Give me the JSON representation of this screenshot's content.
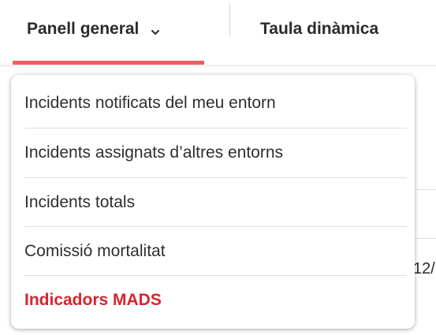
{
  "tabs": {
    "general_label": "Panell general",
    "pivot_label": "Taula dinàmica"
  },
  "dropdown": {
    "items": [
      {
        "label": "Incidents notificats del meu entorn"
      },
      {
        "label": "Incidents assignats d’altres entorns"
      },
      {
        "label": "Incidents totals"
      },
      {
        "label": "Comissió mortalitat"
      },
      {
        "label": "Indicadors MADS"
      }
    ],
    "active_index": 4
  },
  "background": {
    "partial_text": "12/"
  },
  "colors": {
    "accent": "#ef5f5f",
    "active_item": "#d9232f",
    "text": "#2e2e2e"
  },
  "icons": {
    "tab_dropdown": "chevron-down-icon"
  }
}
